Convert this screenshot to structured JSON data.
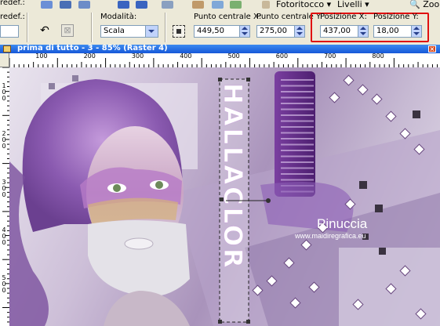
{
  "menu": {
    "preset_label": "redef.:",
    "fotoritocco": "Fotoritocco",
    "livelli": "Livelli",
    "zoom": "Zoom"
  },
  "options": {
    "modalita_label": "Modalità:",
    "modalita_value": "Scala",
    "center_x_label": "Punto centrale X:",
    "center_x_value": "449,50",
    "center_y_label": "Punto centrale Y:",
    "center_y_value": "275,00",
    "pos_x_label": "Posizione X:",
    "pos_x_value": "437,00",
    "pos_y_label": "Posizione Y:",
    "pos_y_value": "18,00",
    "highlight_color": "#e01010"
  },
  "document": {
    "title": "prima di tutto - 3 - 85% (Raster 4)"
  },
  "rulers": {
    "horizontal": [
      "100",
      "200",
      "300",
      "400",
      "500",
      "600",
      "700",
      "800"
    ],
    "vertical": [
      "100",
      "200",
      "300",
      "400",
      "500"
    ]
  },
  "artwork": {
    "vertical_text": "HALLACLOR",
    "watermark_name": "Pinuccia",
    "watermark_url": "www.maidiregrafica.eu"
  }
}
